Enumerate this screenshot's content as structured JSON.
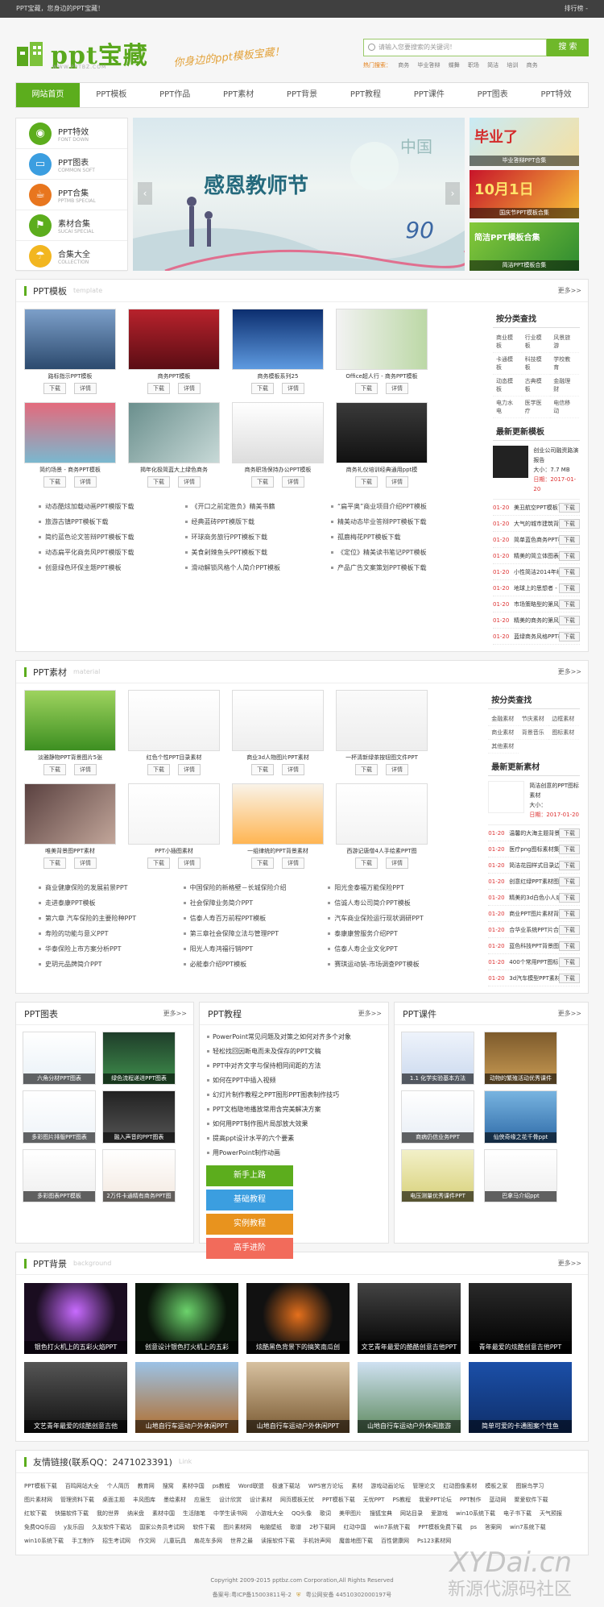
{
  "topbar": {
    "left": "PPT宝藏，您身边的PPT宝藏！",
    "right": "排行榜 -"
  },
  "header": {
    "logo_name": "ppt宝藏",
    "logo_url": "WWW.PPTBZ.COM",
    "slogan": "你身边的ppt模板宝藏！",
    "search_placeholder": "请输入您要搜索的关键词！",
    "search_button": "搜 索",
    "hot_label": "热门搜索：",
    "hot_words": [
      "商务",
      "毕业答辩",
      "蝶舞",
      "职场",
      "简洁",
      "培训",
      "商务"
    ]
  },
  "nav": [
    "网站首页",
    "PPT模板",
    "PPT作品",
    "PPT素材",
    "PPT背景",
    "PPT教程",
    "PPT课件",
    "PPT图表",
    "PPT特效"
  ],
  "side_cats": [
    {
      "t1": "PPT特效",
      "t2": "FONT DOWN",
      "color": "#5cad1d",
      "icon": "gamepad-icon",
      "glyph": "◉"
    },
    {
      "t1": "PPT图表",
      "t2": "COMMON SOFT",
      "color": "#3b9ee0",
      "icon": "monitor-icon",
      "glyph": "▭"
    },
    {
      "t1": "PPT合集",
      "t2": "PPTMB SPECIAL",
      "color": "#e8761e",
      "icon": "cup-icon",
      "glyph": "☕"
    },
    {
      "t1": "素材合集",
      "t2": "SUCAI SPECIAL",
      "color": "#5cad1d",
      "icon": "flag-icon",
      "glyph": "⚑"
    },
    {
      "t1": "合集大全",
      "t2": "COLLECTION",
      "color": "#f2b620",
      "icon": "umbrella-icon",
      "glyph": "☂"
    }
  ],
  "slider": {
    "title": "感恩教师节",
    "cn": "中国",
    "num": "90"
  },
  "promo": [
    {
      "cap": "毕业答辩PPT合集",
      "bg": "linear-gradient(135deg,#c9eaf5,#f6e0a0)",
      "big": "毕业了",
      "bigcolor": "#d42a2a"
    },
    {
      "cap": "国庆节PPT模板合集",
      "bg": "linear-gradient(135deg,#c8142a,#f7c337)",
      "big": "10月1日",
      "bigcolor": "#ffe36a"
    },
    {
      "cap": "简洁PPT模板合集",
      "bg": "linear-gradient(135deg,#86c93a,#2e8b30)",
      "big": "简洁PPT模板合集",
      "bigcolor": "#fff"
    }
  ],
  "tpl": {
    "title": "PPT模板",
    "en": "template",
    "more": "更多>>",
    "items": [
      {
        "cap": "路标指示PPT模板",
        "bg": "linear-gradient(180deg,#7c9fc9,#2c4a6e)"
      },
      {
        "cap": "商务PPT模板",
        "bg": "linear-gradient(180deg,#b8222c,#5a0d14)"
      },
      {
        "cap": "商务模板系列25",
        "bg": "linear-gradient(180deg,#0c2e6f,#5e9ae0)"
      },
      {
        "cap": "Office超人行 - 商务PPT模板",
        "bg": "linear-gradient(90deg,#f2f2f2,#bcd8a6)"
      },
      {
        "cap": "简约场景 - 商务PPT模板",
        "bg": "linear-gradient(180deg,#e46a7c,#7ab8cf)"
      },
      {
        "cap": "揭年化极简蓝大上绿色商务",
        "bg": "linear-gradient(135deg,#6a8f8d,#c7d9d7)"
      },
      {
        "cap": "商务职场保持办公PPT模板",
        "bg": "linear-gradient(180deg,#fff,#ddd)"
      },
      {
        "cap": "商务礼仪培训经典通用ppt模",
        "bg": "linear-gradient(180deg,#3a3a3a,#111)"
      }
    ],
    "btn_dl": "下载",
    "btn_detail": "详情",
    "links": [
      "动态酷炫加载动画PPT模版下载",
      "《开口之前定胜负》精美书籍",
      "“扁平奥”商业项目介绍PPT模板",
      "旅游古镇PPT模板下载",
      "经典蓝砖PPT模版下载",
      "精美动态毕业答辩PPT模板下载",
      "简约蓝色论文答辩PPT模板下载",
      "环球商务旅行PPT模板下载",
      "孤鹿梅花PPT模板下载",
      "动态扁平化商务风PPT模版下载",
      "美食剁辣鱼头PPT模板下载",
      "《定位》精美读书笔记PPT模板",
      "创意绿色环保主题PPT模板",
      "滑动解锁风格个人简介PPT模板",
      "产品广告文案策划PPT模板下载"
    ],
    "side_h1": "按分类查找",
    "side_cats": [
      "商业模板",
      "行业模板",
      "风景旅游",
      "卡通模板",
      "科技模板",
      "学校教育",
      "动态模板",
      "古典模板",
      "金融理财",
      "电力水电",
      "医学医疗",
      "电信移动"
    ],
    "side_h2": "最新更新模板",
    "feat": {
      "title": "创业公司融资路演报告",
      "size": "大小：7.7 MB",
      "date": "日期：2017-01-20"
    },
    "dl": [
      {
        "d": "01-20",
        "n": "美丑航空PPT模板下"
      },
      {
        "d": "01-20",
        "n": "大气的城市建筑背景"
      },
      {
        "d": "01-20",
        "n": "简单蓝色商务PPT模"
      },
      {
        "d": "01-20",
        "n": "精美的简立体图表商"
      },
      {
        "d": "01-20",
        "n": "小性简洁2014年经"
      },
      {
        "d": "01-20",
        "n": "地球上的思想者 -"
      },
      {
        "d": "01-20",
        "n": "市场策略型的第风风"
      },
      {
        "d": "01-20",
        "n": "精美的商务的第风"
      },
      {
        "d": "01-20",
        "n": "蓝绿商务风格PPT模"
      }
    ],
    "dl_btn": "下载"
  },
  "mat": {
    "title": "PPT素材",
    "en": "material",
    "more": "更多>>",
    "items": [
      {
        "cap": "淡雅静物PPT背景图片5张",
        "bg": "linear-gradient(180deg,#9ed35e,#3d8f21)"
      },
      {
        "cap": "红色个性PPT目录素材",
        "bg": "linear-gradient(180deg,#fff,#f2f2f2)"
      },
      {
        "cap": "商业3d人物图片PPT素材",
        "bg": "linear-gradient(180deg,#fff,#eee)"
      },
      {
        "cap": "一杯清新绿茶按钮图文件PPT",
        "bg": "linear-gradient(180deg,#fafafa,#eee)"
      },
      {
        "cap": "唯美背景图PPT素材",
        "bg": "linear-gradient(135deg,#5a4140,#c2a69a)"
      },
      {
        "cap": "PPT小插图素材",
        "bg": "linear-gradient(180deg,#fff,#f5f5f5)"
      },
      {
        "cap": "一组律统的PPT背景素材",
        "bg": "linear-gradient(180deg,#f9f3e8,#ffb552)"
      },
      {
        "cap": "西游记唐僧4人手绘素PPT图",
        "bg": "linear-gradient(180deg,#fff,#f3f3f3)"
      }
    ],
    "links": [
      "商业健康保险的发展前景PPT",
      "中国保险的新格壁－长城保险介绍",
      "阳光金泰福万能保险PPT",
      "走进泰康PPT模板",
      "社会保障业务简介PPT",
      "信诚人寿公司简介PPT模板",
      "第六章 汽车保险的主要险种PPT",
      "信泰人寿百万前程PPT模板",
      "汽车商业保险运行现状调研PPT",
      "寿险的功能与意义PPT",
      "第三章社会保障立法与管理PPT",
      "泰康康营服务介绍PPT",
      "华泰保险上市方案分析PPT",
      "阳光人寿鸿福行销PPT",
      "信泰人寿企业文化PPT",
      "史玥元品牌简介PPT",
      "必能泰介绍PPT模板",
      "赛琪运动装-市场调查PPT模板"
    ],
    "side_h1": "按分类查找",
    "side_cats": [
      "金融素材",
      "节庆素材",
      "边框素材",
      "商业素材",
      "背景音乐",
      "图标素材",
      "其他素材"
    ],
    "side_h2": "最新更新素材",
    "feat": {
      "title": "简洁创意的PPT图标素材",
      "size": "大小：",
      "date": "日期：2017-01-20"
    },
    "dl": [
      {
        "d": "01-20",
        "n": "温馨的大海主题背景"
      },
      {
        "d": "01-20",
        "n": "医疗png图标素材集"
      },
      {
        "d": "01-20",
        "n": "简洁花园样式目录边"
      },
      {
        "d": "01-20",
        "n": "创意红绿PPT素材图"
      },
      {
        "d": "01-20",
        "n": "精美的3d白色小人或"
      },
      {
        "d": "01-20",
        "n": "商业PPT图片素材背"
      },
      {
        "d": "01-20",
        "n": "合华业系统PPT片合辑"
      },
      {
        "d": "01-20",
        "n": "蓝色科技PPT背景图"
      },
      {
        "d": "01-20",
        "n": "400个常用PPT图标"
      },
      {
        "d": "01-20",
        "n": "3d汽车模型PPT素材"
      }
    ],
    "dl_btn": "下载"
  },
  "charts": {
    "title": "PPT图表",
    "more": "更多>>",
    "items": [
      {
        "cap": "六角分材PPT图表",
        "bg": "linear-gradient(180deg,#fff,#e9f1f7)"
      },
      {
        "cap": "绿色流程递进PPT图表",
        "bg": "linear-gradient(180deg,#1f3d2a,#3f8f4c)"
      },
      {
        "cap": "多彩图片排版PPT图表",
        "bg": "linear-gradient(180deg,#fff,#eef3f8)"
      },
      {
        "cap": "融入声音的PPT图表",
        "bg": "linear-gradient(180deg,#222,#555)"
      },
      {
        "cap": "多彩图表PPT模板",
        "bg": "linear-gradient(180deg,#fff,#eee)"
      },
      {
        "cap": "2万件卡通精有商务PPT图",
        "bg": "linear-gradient(180deg,#fff,#f3e9e0)"
      }
    ]
  },
  "tutorials": {
    "title": "PPT教程",
    "more": "更多>>",
    "items": [
      "PowerPoint常见问题及对策之如何对齐多个对象",
      "轻松找回因断电而未及保存的PPT文稿",
      "PPT中对齐文字与保持相同间距的方法",
      "如何在PPT中插入视频",
      "幻灯片制作教程之PPT图形PPT图表制作技巧",
      "PPT文档隐地播放常用含完美解决方案",
      "如何用PPT制作图片局部放大效果",
      "提高ppt设计水平的六个要素",
      "用PowerPoint制作动画"
    ],
    "tiles": [
      {
        "t": "新手上路",
        "c": "#5cad1d"
      },
      {
        "t": "基础教程",
        "c": "#3b9ee0"
      },
      {
        "t": "实例教程",
        "c": "#e8931e"
      },
      {
        "t": "高手进阶",
        "c": "#f26b5b"
      }
    ]
  },
  "courseware": {
    "title": "PPT课件",
    "more": "更多>>",
    "items": [
      {
        "cap": "1.1 化学实验基本方法",
        "bg": "linear-gradient(180deg,#eef3fb,#cbd9ee)"
      },
      {
        "cap": "动物的繁殖活动优秀课件",
        "bg": "linear-gradient(180deg,#7d5a2c,#c89a53)"
      },
      {
        "cap": "商病仍信业务PPT",
        "bg": "linear-gradient(180deg,#fff,#e8eef5)"
      },
      {
        "cap": "仙侠奇缘之花千骨ppt",
        "bg": "linear-gradient(180deg,#78b4e0,#2f6ba8)"
      },
      {
        "cap": "电压测量优秀课件PPT",
        "bg": "linear-gradient(180deg,#f2f0c8,#d8d17a)"
      },
      {
        "cap": "巴拿马介绍ppt",
        "bg": "linear-gradient(180deg,#fff,#eee)"
      }
    ]
  },
  "bgsec": {
    "title": "PPT背景",
    "en": "background",
    "more": "更多>>",
    "items": [
      {
        "cap": "银色打火机上的五彩火焰PPT",
        "bg": "radial-gradient(circle at 50% 40%,#c86bff,#1a0d20 60%)"
      },
      {
        "cap": "创意设计银色打火机上的五彩",
        "bg": "radial-gradient(circle at 50% 40%,#6cd36c,#0a140a 60%)"
      },
      {
        "cap": "炫酷黑色背景下的搞笑南瓜创",
        "bg": "radial-gradient(circle at 50% 45%,#e5701c,#111 55%)"
      },
      {
        "cap": "文艺青年最爱的酷酷创意吉他PPT",
        "bg": "linear-gradient(180deg,#444,#000)"
      },
      {
        "cap": "青年最爱的炫酷创意吉他PPT",
        "bg": "linear-gradient(180deg,#2a2a2a,#000)"
      },
      {
        "cap": "文艺青年最爱的炫酷创意吉他",
        "bg": "linear-gradient(180deg,#555,#111)"
      },
      {
        "cap": "山地自行车运动户外休闲PPT",
        "bg": "linear-gradient(180deg,#9bc2e6,#b36d2a)"
      },
      {
        "cap": "山地自行车运动户外休闲PPT",
        "bg": "linear-gradient(180deg,#d7c1a0,#7a5a32)"
      },
      {
        "cap": "山地自行车运动户外休闲旅游",
        "bg": "linear-gradient(180deg,#cfe1f2,#5e8a5e)"
      },
      {
        "cap": "简单可爱的卡通图案个性鱼",
        "bg": "linear-gradient(180deg,#1b4fa8,#0f2f6a)"
      }
    ]
  },
  "friends": {
    "title": "友情链接(联系QQ：2471023391)",
    "en": "Link",
    "items": [
      "PPT模板下载",
      "百鸣网站大全",
      "个人简历",
      "教育网",
      "搜窝",
      "素材中国",
      "ps教程",
      "Word联盟",
      "极速下载站",
      "WPS官方论坛",
      "素材",
      "游戏动画论坛",
      "管理论文",
      "红动图像素材",
      "模板之家",
      "图娱鸟学习",
      "图片素材网",
      "管理资料下载",
      "桌面主题",
      "丰风图库",
      "墨绘素材",
      "应届生",
      "设计欣赏",
      "设计素材",
      "网页模板无忧",
      "PPT模板下载",
      "无忧PPT",
      "PS教程",
      "我爱PPT论坛",
      "PPT制作",
      "蓝动网",
      "聚爱软件下载",
      "红软下载",
      "快猫软件下载",
      "我的世界",
      "纳米盘",
      "素材中国",
      "生活随笔",
      "中学生读书网",
      "小游戏大全",
      "QQ头像",
      "歌词",
      "美甲图片",
      "搜狐宝典",
      "网站目录",
      "爱游戏",
      "win10系统下载",
      "电子书下载",
      "天气预报",
      "免费QQ乐园",
      "y友乐园",
      "久友软件下载站",
      "国家公务员考试网",
      "软件下载",
      "图片素材网",
      "电脑壁纸",
      "歌谱",
      "2秒下载网",
      "红动中国",
      "win7系统下载",
      "PPT模板免费下载",
      "ps",
      "答案网",
      "win7系统下载",
      "win10系统下载",
      "手工制作",
      "招生考试网",
      "作文网",
      "儿童玩具",
      "扇花车多网",
      "世界之最",
      "读报软件下载",
      "手机铃声网",
      "魔兽地图下载",
      "百性健康网",
      "Ps123素材网"
    ]
  },
  "footer": {
    "copy": "Copyright   2009-2015 pptbz.com Corporation,All Rights Reserved",
    "icp": "备案号:粤ICP备15003811号-2",
    "police": "粤公网安备 44510302000197号"
  },
  "watermark": {
    "line1": "XYDai.cn",
    "line2": "新源代源码社区"
  }
}
